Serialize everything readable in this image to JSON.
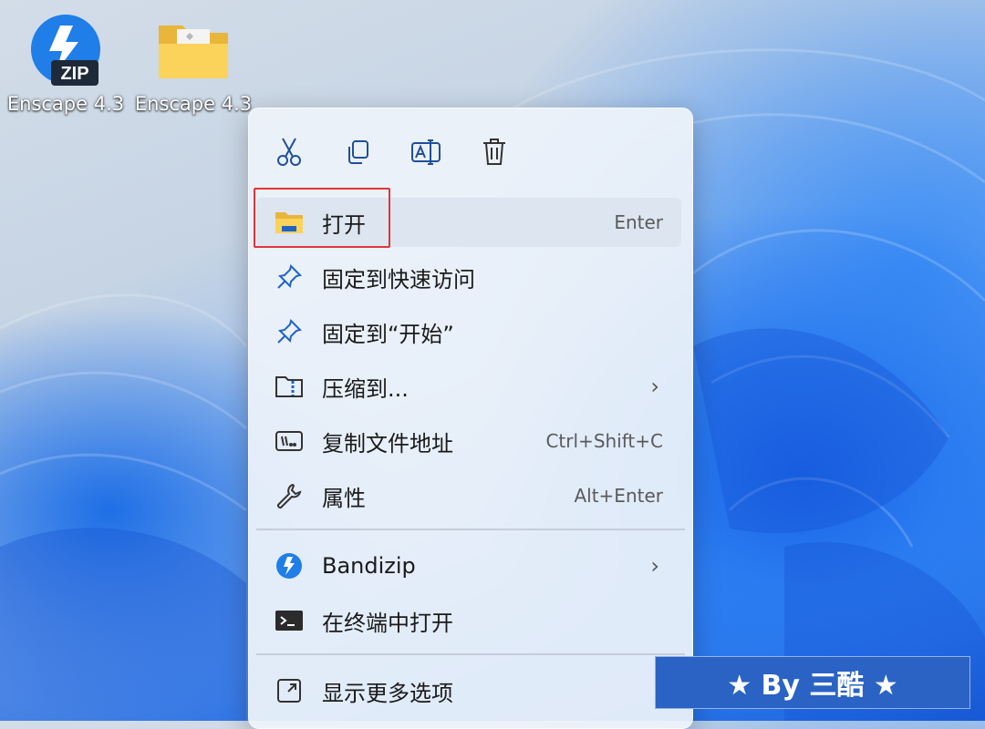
{
  "desktop": {
    "icons": [
      {
        "label": "Enscape 4.3",
        "icon": "bandizip-zip-icon",
        "badge": "ZIP"
      },
      {
        "label": "Enscape 4.3",
        "icon": "folder-icon"
      }
    ]
  },
  "menu": {
    "toolbar": [
      {
        "name": "cut",
        "icon": "scissors-icon"
      },
      {
        "name": "copy",
        "icon": "copy-icon"
      },
      {
        "name": "rename",
        "icon": "rename-icon"
      },
      {
        "name": "delete",
        "icon": "trash-icon"
      }
    ],
    "items": [
      {
        "label": "打开",
        "shortcut": "Enter",
        "icon": "folder-open-icon"
      },
      {
        "label": "固定到快速访问",
        "shortcut": "",
        "icon": "pin-icon"
      },
      {
        "label": "固定到“开始”",
        "shortcut": "",
        "icon": "pin-icon"
      },
      {
        "label": "压缩到...",
        "shortcut": "",
        "icon": "compress-icon",
        "submenu": "›"
      },
      {
        "label": "复制文件地址",
        "shortcut": "Ctrl+Shift+C",
        "icon": "copy-path-icon"
      },
      {
        "label": "属性",
        "shortcut": "Alt+Enter",
        "icon": "wrench-icon"
      },
      {
        "label": "Bandizip",
        "shortcut": "",
        "icon": "bandizip-icon",
        "submenu": "›"
      },
      {
        "label": "在终端中打开",
        "shortcut": "",
        "icon": "terminal-icon"
      },
      {
        "label": "显示更多选项",
        "shortcut": "",
        "icon": "more-options-icon"
      }
    ]
  },
  "watermark": {
    "text": "★ By 三酷 ★"
  },
  "colors": {
    "accent": "#0067c0",
    "highlight_border": "#e0353a",
    "watermark_bg": "#2a63c3"
  }
}
